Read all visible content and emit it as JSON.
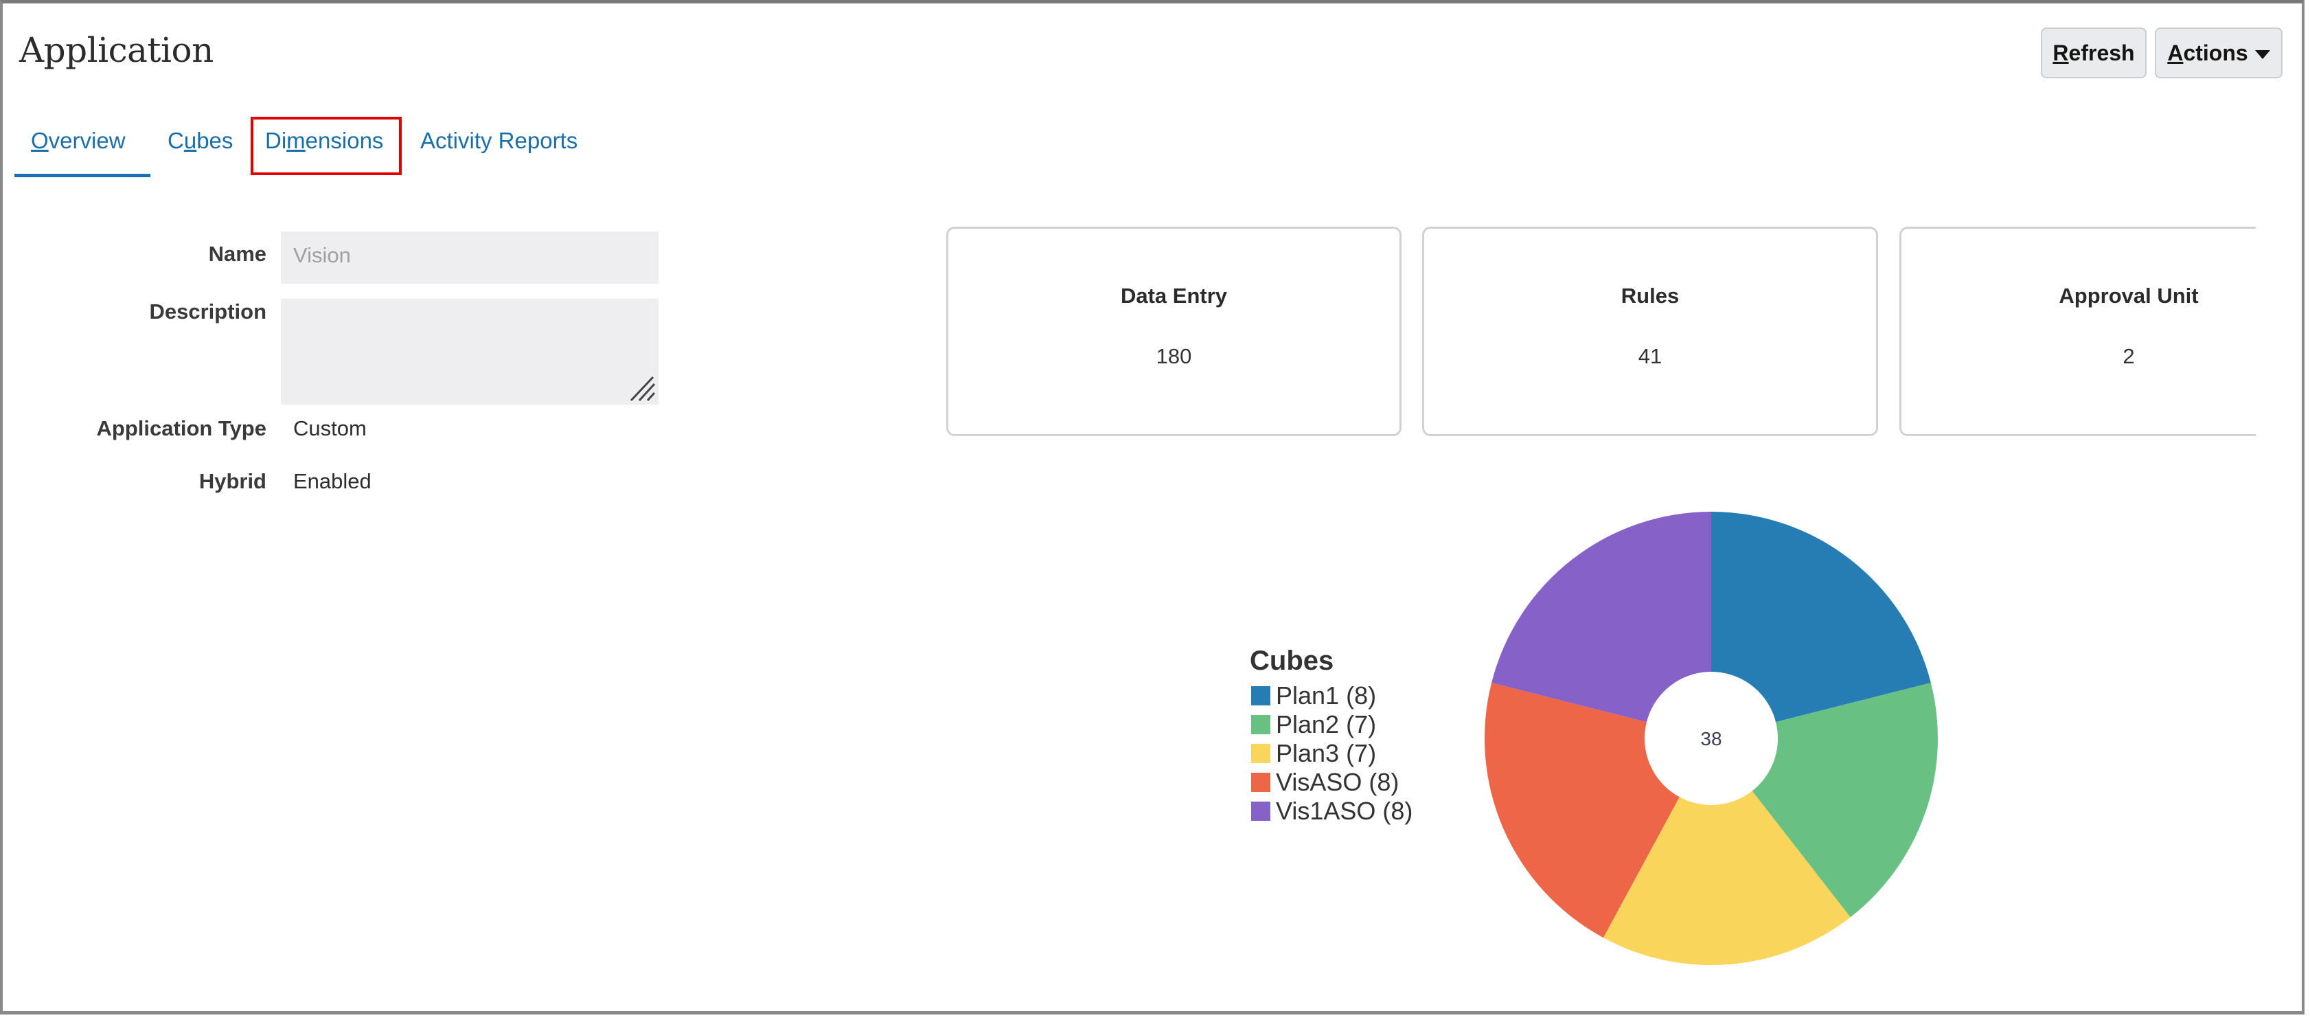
{
  "header": {
    "title": "Application",
    "refresh_label": "Refresh",
    "refresh_mnemonic": "R",
    "refresh_rest": "efresh",
    "actions_label": "Actions",
    "actions_mnemonic": "A",
    "actions_rest": "ctions"
  },
  "tabs": [
    {
      "label": "Overview",
      "mnemonic_pre": "",
      "mnemonic": "O",
      "mnemonic_post": "verview",
      "active": true
    },
    {
      "label": "Cubes",
      "mnemonic_pre": "C",
      "mnemonic": "u",
      "mnemonic_post": "bes",
      "active": false
    },
    {
      "label": "Dimensions",
      "mnemonic_pre": "Di",
      "mnemonic": "m",
      "mnemonic_post": "ensions",
      "active": false,
      "highlighted": true
    },
    {
      "label": "Activity Reports",
      "mnemonic_pre": "Activity Reports",
      "mnemonic": "",
      "mnemonic_post": "",
      "active": false
    }
  ],
  "form": {
    "name_label": "Name",
    "name_value": "Vision",
    "description_label": "Description",
    "description_value": "",
    "app_type_label": "Application Type",
    "app_type_value": "Custom",
    "hybrid_label": "Hybrid",
    "hybrid_value": "Enabled"
  },
  "cards": [
    {
      "title": "Data Entry",
      "value": "180"
    },
    {
      "title": "Rules",
      "value": "41"
    },
    {
      "title": "Approval Unit",
      "value": "2"
    }
  ],
  "colors": {
    "accent": "#1a6fb3",
    "highlight_box": "#e00000"
  },
  "chart_data": {
    "type": "pie",
    "variant": "donut",
    "title": "Cubes",
    "center_label": "38",
    "categories": [
      "Plan1",
      "Plan2",
      "Plan3",
      "VisASO",
      "Vis1ASO"
    ],
    "values": [
      8,
      7,
      7,
      8,
      8
    ],
    "legend_labels": [
      "Plan1 (8)",
      "Plan2 (7)",
      "Plan3 (7)",
      "VisASO (8)",
      "Vis1ASO (8)"
    ],
    "colors": [
      "#267db3",
      "#68c182",
      "#fad55c",
      "#ed6647",
      "#8561c8"
    ],
    "legend": "left",
    "start": "top",
    "direction": "clockwise"
  }
}
